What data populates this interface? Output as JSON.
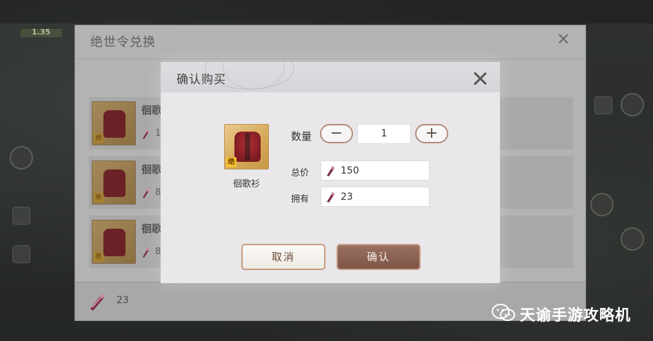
{
  "background_panel": {
    "title": "绝世令兑换",
    "rows": [
      {
        "name": "徊歌",
        "price": "1",
        "grade_tag": "绝"
      },
      {
        "name": "徊歌",
        "price": "8",
        "grade_tag": "绝"
      },
      {
        "name": "徊歌",
        "price": "8",
        "grade_tag": "绝"
      }
    ],
    "footer_currency": "23"
  },
  "hud": {
    "level": "1.35"
  },
  "dialog": {
    "title": "确认购买",
    "item": {
      "name": "徊歌衫",
      "grade_tag": "绝"
    },
    "quantity_label": "数量",
    "quantity_value": "1",
    "minus_symbol": "−",
    "plus_symbol": "+",
    "total_label": "总价",
    "total_value": "150",
    "owned_label": "拥有",
    "owned_value": "23",
    "cancel_label": "取消",
    "confirm_label": "确认"
  },
  "watermark": {
    "text": "天谕手游攻略机"
  },
  "colors": {
    "dialog_bg": "#e9e7ea",
    "button_border": "#b58b78",
    "confirm_bg": "#8b6354",
    "currency_icon": "#7a2c4a"
  },
  "icons": {
    "close": "close-icon",
    "currency": "jueshi-token-icon",
    "minus": "minus-icon",
    "plus": "plus-icon",
    "watermark": "wechat-icon"
  }
}
